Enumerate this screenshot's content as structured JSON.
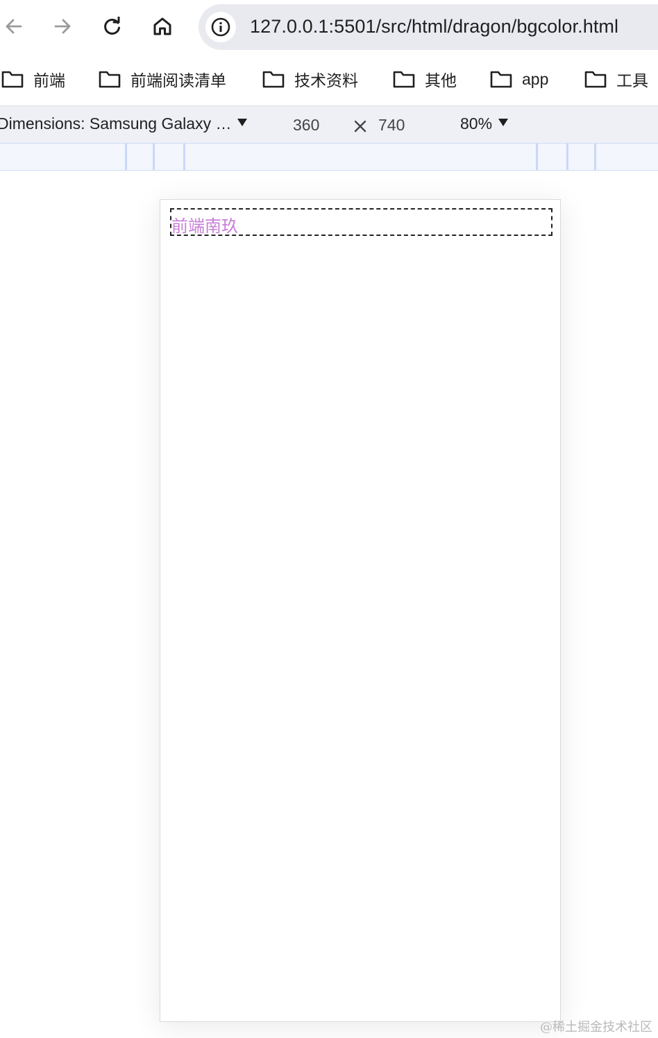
{
  "navbar": {
    "url": "127.0.0.1:5501/src/html/dragon/bgcolor.html",
    "icons": {
      "back": "arrow-left-icon",
      "forward": "arrow-right-icon",
      "reload": "reload-icon",
      "home": "home-icon",
      "site_info": "info-icon"
    }
  },
  "bookmarks": {
    "items": [
      {
        "label": "前端",
        "icon": "folder-icon"
      },
      {
        "label": "前端阅读清单",
        "icon": "folder-icon"
      },
      {
        "label": "技术资料",
        "icon": "folder-icon"
      },
      {
        "label": "其他",
        "icon": "folder-icon"
      },
      {
        "label": "app",
        "icon": "folder-icon"
      },
      {
        "label": "工具",
        "icon": "folder-icon"
      }
    ]
  },
  "device_toolbar": {
    "dimensions_label": "Dimensions: Samsung Galaxy …",
    "width": "360",
    "height": "740",
    "zoom": "80%"
  },
  "page": {
    "text": "前端南玖",
    "text_color": "#c77fd7"
  },
  "watermark": "@稀土掘金技术社区",
  "colors": {
    "omnibox_bg": "#e9eaf0",
    "toolbar_bg": "#eef0f5",
    "ruler_bg": "#f3f6fd"
  }
}
